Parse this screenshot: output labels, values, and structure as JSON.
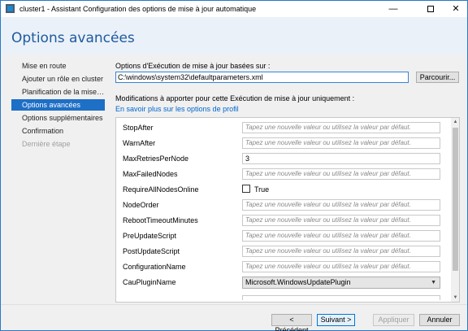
{
  "window": {
    "title": "cluster1 - Assistant Configuration des options de mise à jour automatique",
    "minimize_glyph": "—",
    "close_glyph": "✕"
  },
  "header": {
    "title": "Options avancées"
  },
  "nav": {
    "items": [
      {
        "label": "Mise en route",
        "state": "normal"
      },
      {
        "label": "Ajouter un rôle en cluster",
        "state": "normal"
      },
      {
        "label": "Planification de la mise à j...",
        "state": "normal"
      },
      {
        "label": "Options avancées",
        "state": "active"
      },
      {
        "label": "Options supplémentaires",
        "state": "normal"
      },
      {
        "label": "Confirmation",
        "state": "normal"
      },
      {
        "label": "Dernière étape",
        "state": "disabled"
      }
    ]
  },
  "main": {
    "options_label": "Options d'Exécution de mise à jour basées sur :",
    "options_path": "C:\\windows\\system32\\defaultparameters.xml",
    "browse_label": "Parcourir...",
    "modifications_label": "Modifications à apporter pour cette Exécution de mise à jour uniquement :",
    "profile_link": "En savoir plus sur les options de profil",
    "placeholder": "Tapez une nouvelle valeur ou utilisez la valeur par défaut.",
    "rows": [
      {
        "label": "StopAfter",
        "value": ""
      },
      {
        "label": "WarnAfter",
        "value": ""
      },
      {
        "label": "MaxRetriesPerNode",
        "value": "3"
      },
      {
        "label": "MaxFailedNodes",
        "value": ""
      },
      {
        "label": "RequireAllNodesOnline",
        "checkbox_label": "True"
      },
      {
        "label": "NodeOrder",
        "value": ""
      },
      {
        "label": "RebootTimeoutMinutes",
        "value": ""
      },
      {
        "label": "PreUpdateScript",
        "value": ""
      },
      {
        "label": "PostUpdateScript",
        "value": ""
      },
      {
        "label": "ConfigurationName",
        "value": ""
      },
      {
        "label": "CauPluginName",
        "select_value": "Microsoft.WindowsUpdatePlugin"
      }
    ]
  },
  "footer": {
    "previous": "< Précédent",
    "next": "Suivant >",
    "apply": "Appliquer",
    "cancel": "Annuler"
  }
}
